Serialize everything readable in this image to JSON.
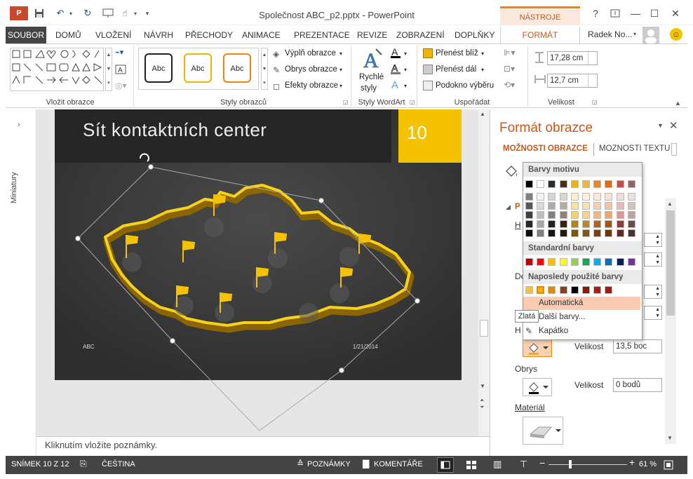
{
  "window": {
    "title": "Společnost ABC_p2.pptx - PowerPoint",
    "contextual_group": "NÁSTROJE KRESLENÍ",
    "help": "?",
    "min": "—",
    "max": "☐",
    "close": "✕"
  },
  "tabs": [
    "SOUBOR",
    "DOMŮ",
    "VLOŽENÍ",
    "NÁVRH",
    "PŘECHODY",
    "ANIMACE",
    "PREZENTACE",
    "REVIZE",
    "ZOBRAZENÍ",
    "DOPLŇKY",
    "FORMÁT"
  ],
  "user": {
    "name": "Radek No..."
  },
  "ribbon": {
    "insert_shapes": {
      "label": "Vložit obrazce"
    },
    "shape_styles": {
      "label": "Styly obrazců",
      "samples": [
        "Abc",
        "Abc",
        "Abc"
      ],
      "fill": "Výplň obrazce",
      "outline": "Obrys obrazce",
      "effects": "Efekty obrazce"
    },
    "wordart": {
      "label": "Styly WordArt",
      "quick": "Rychlé",
      "quick2": "styly"
    },
    "arrange": {
      "label": "Uspořádat",
      "forward": "Přenést blíž",
      "backward": "Přenést dál",
      "pane": "Podokno výběru"
    },
    "size": {
      "label": "Velikost",
      "height": "17,28 cm",
      "width": "12,7 cm"
    }
  },
  "left_pane": {
    "label": "Miniatury"
  },
  "slide": {
    "title": "Sít kontaktních center",
    "number": "10",
    "footer_left": "ABC",
    "footer_date": "1/21/2014"
  },
  "notes": {
    "placeholder": "Kliknutím vložíte poznámky."
  },
  "format_pane": {
    "title": "Formát obrazce",
    "tab_shape": "MOŽNOSTI OBRAZCE",
    "tab_text": "MOŽNOSTI TEXTU",
    "section_marker": "P",
    "row_h1": "H",
    "row_d": "De",
    "row_h2": "H",
    "velikost_label1": "Velikost",
    "velikost_value1": "13,5 boc",
    "obrys_label": "Obrys",
    "velikost_label2": "Velikost",
    "velikost_value2": "0 bodů",
    "material_label": "Materiál"
  },
  "palette": {
    "theme_header": "Barvy motivu",
    "standard_header": "Standardní barvy",
    "recent_header": "Naposledy použité barvy",
    "automatic": "Automatická",
    "more": "Další barvy...",
    "eyedropper": "Kapátko",
    "theme_colors": [
      "#000000",
      "#ffffff",
      "#2c2c2c",
      "#4b2f14",
      "#f0b400",
      "#f3b43c",
      "#ea8628",
      "#e46c0a",
      "#c0504d",
      "#8f6565"
    ],
    "standard_colors": [
      "#c00000",
      "#ff0000",
      "#ffc000",
      "#ffff00",
      "#92d050",
      "#00b050",
      "#00b0f0",
      "#0070c0",
      "#002060",
      "#7030a0"
    ],
    "recent_colors": [
      "#f5c33b",
      "#f0b400",
      "#e08a00",
      "#8b3e12",
      "#000000",
      "#8b1a0a",
      "#b01c10",
      "#a31a10"
    ]
  },
  "tooltip": {
    "text": "Zlatá"
  },
  "status": {
    "slide": "SNÍMEK 10 Z 12",
    "language": "ČEŠTINA",
    "notes": "POZNÁMKY",
    "comments": "KOMENTÁŘE",
    "zoom": "61 %"
  }
}
